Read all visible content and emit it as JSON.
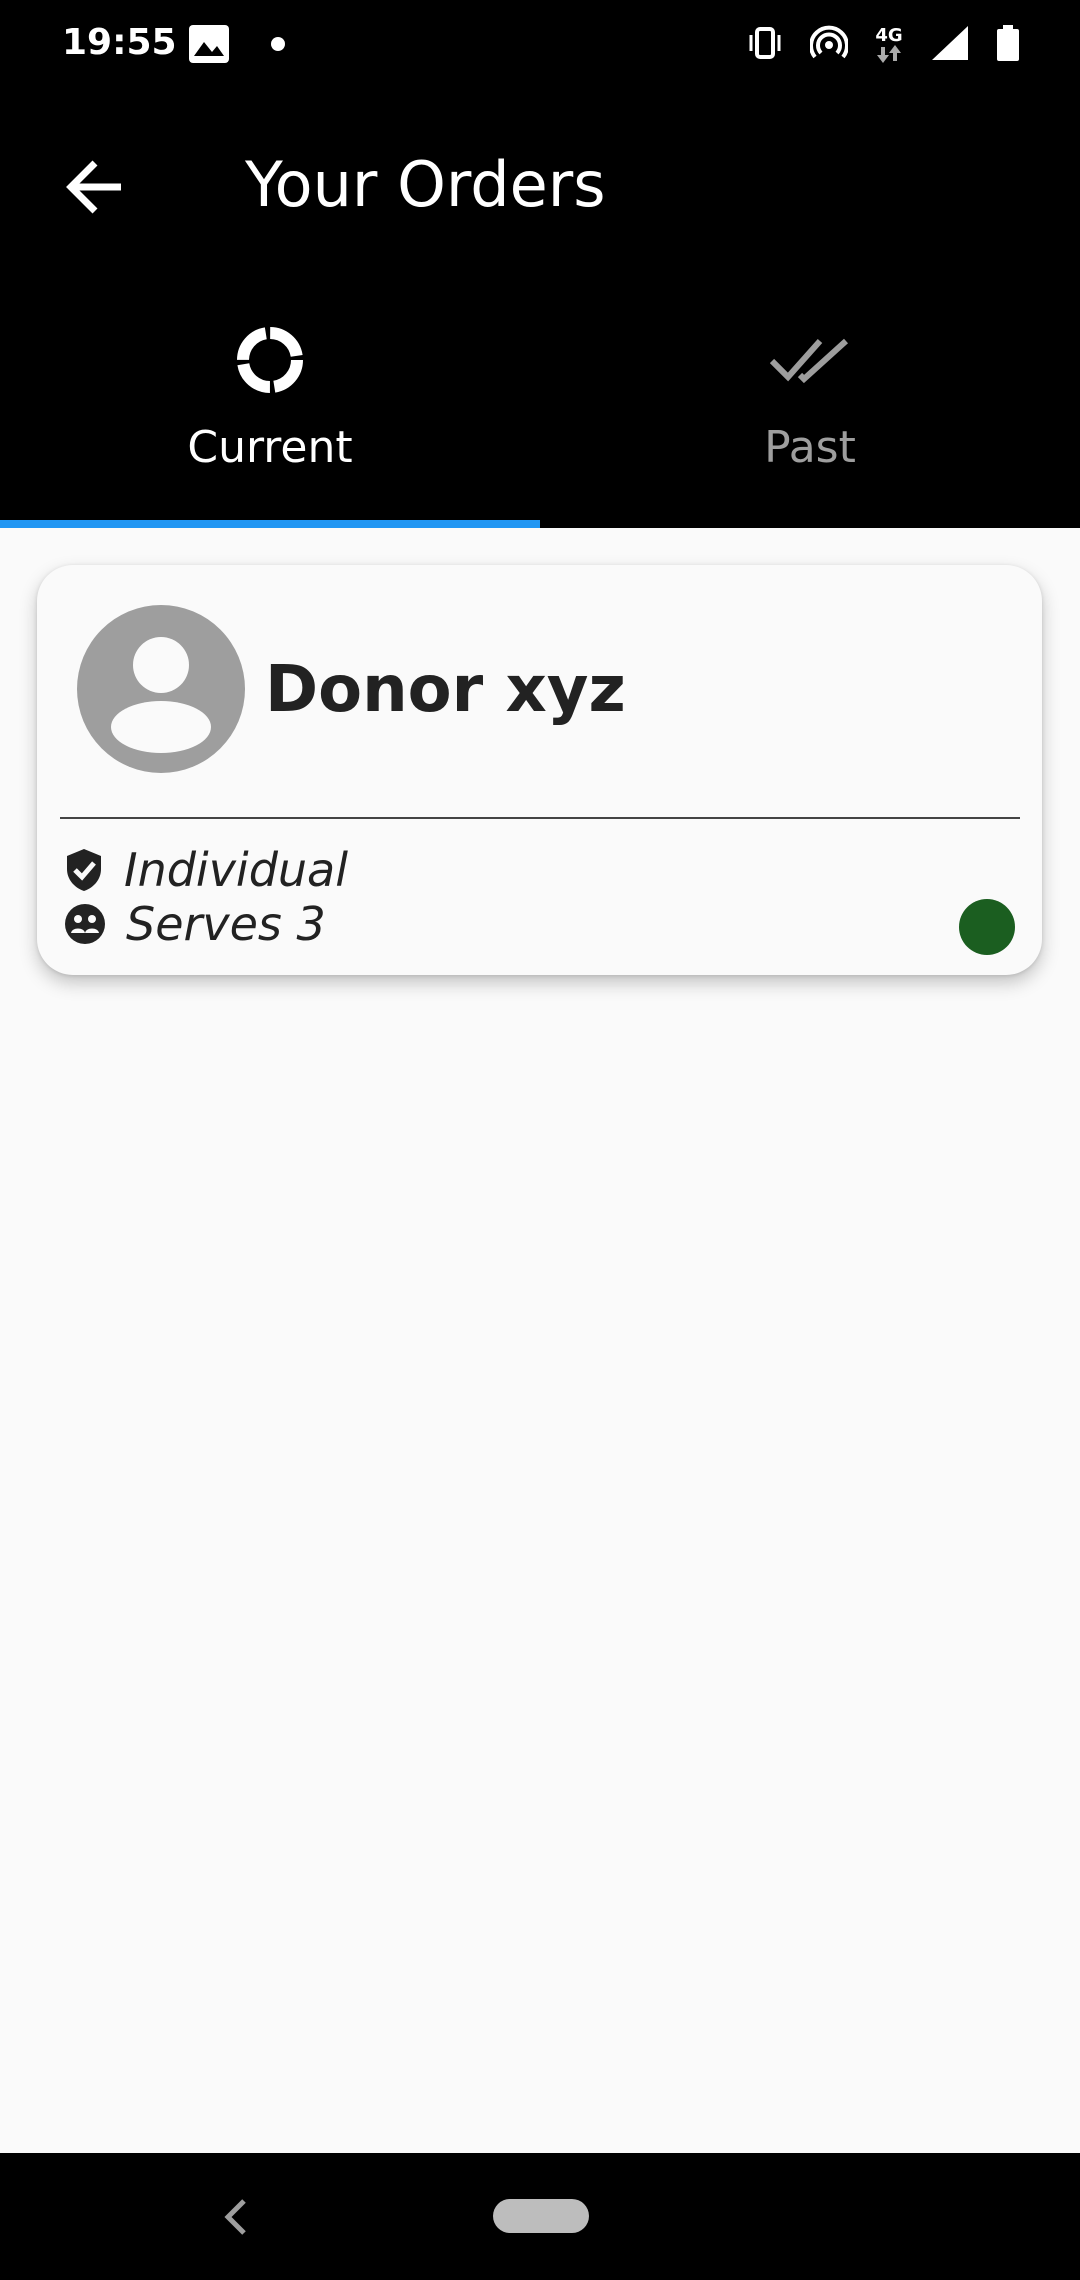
{
  "status_bar": {
    "time": "19:55",
    "left_icons": [
      "image-icon",
      "dot-icon"
    ],
    "right_icons": [
      "vibrate-icon",
      "hotspot-icon",
      "network-4g-icon",
      "signal-icon",
      "battery-icon"
    ],
    "network_label": "4G"
  },
  "app_bar": {
    "title": "Your Orders",
    "back_icon": "arrow-back-icon"
  },
  "tabs": [
    {
      "label": "Current",
      "icon": "progress-ring-icon",
      "selected": true
    },
    {
      "label": "Past",
      "icon": "done-all-icon",
      "selected": false
    }
  ],
  "orders": [
    {
      "donor_name": "Donor xyz",
      "type": "Individual",
      "serves": "Serves 3",
      "status_color": "#1b5e20"
    }
  ],
  "colors": {
    "tab_indicator": "#2196f3",
    "app_bar_bg": "#000000",
    "page_bg": "#fafafa"
  },
  "nav_bar": {
    "icons": [
      "nav-back-icon",
      "nav-home-pill"
    ]
  }
}
